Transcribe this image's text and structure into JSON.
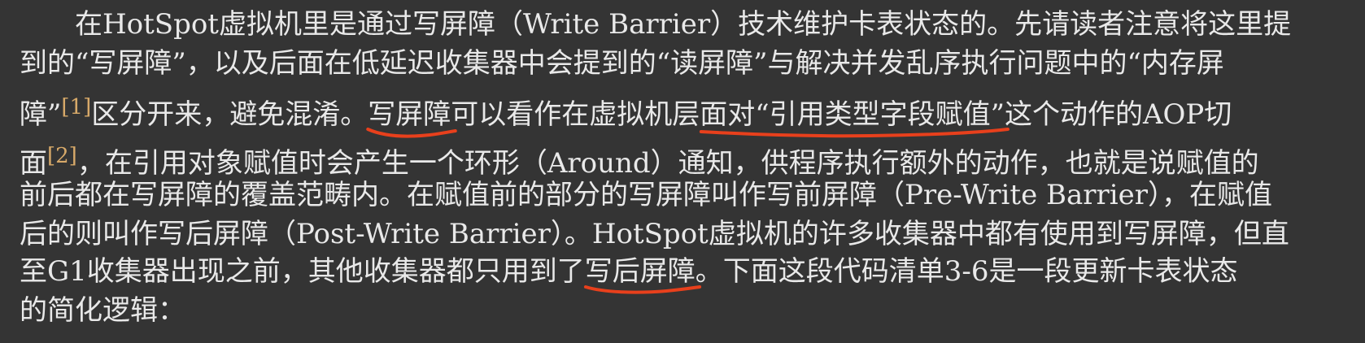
{
  "paragraph": {
    "line1": "在HotSpot虚拟机里是通过写屏障（Write Barrier）技术维护卡表状态的。先请读者注意将这里提",
    "line2": "到的“写屏障”，以及后面在低延迟收集器中会提到的“读屏障”与解决并发乱序执行问题中的“内存屏",
    "line3_a": "障”",
    "fn1": "[1]",
    "line3_b": "区分开来，避免混淆。",
    "line3_mark1": "写屏障",
    "line3_c": "可以看作在虚拟机层",
    "line3_mark2": "面对“引用类型字段赋值”",
    "line3_d": "这个动作的AOP切",
    "line4_a": "面",
    "fn2": "[2]",
    "line4_b": "，在引用对象赋值时会产生一个环形（Around）通知，供程序执行额外的动作，也就是说赋值的",
    "line5": "前后都在写屏障的覆盖范畴内。在赋值前的部分的写屏障叫作写前屏障（Pre-Write Barrier），在赋值",
    "line6": "后的则叫作写后屏障（Post-Write Barrier）。HotSpot虚拟机的许多收集器中都有使用到写屏障，但直",
    "line7_a": "至G1收集器出现之前，其他收集器都只用到了",
    "line7_mark": "写后屏障",
    "line7_b": "。下面这段代码清单3-6是一段更新卡表状态",
    "line8": "的简化逻辑："
  },
  "colors": {
    "background": "#343434",
    "text": "#e9e9e9",
    "footnote": "#d7a969",
    "annotation": "#e8401c"
  }
}
